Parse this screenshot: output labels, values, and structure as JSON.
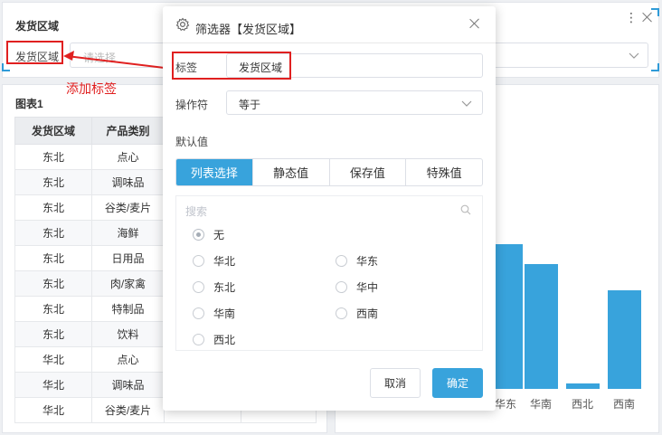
{
  "filter_widget": {
    "title": "发货区域",
    "label": "发货区域",
    "placeholder": "请选择",
    "menu_icon": "more-vertical-icon",
    "close_icon": "close-icon"
  },
  "annotation": {
    "text": "添加标签",
    "color": "#e02020"
  },
  "table_widget": {
    "title": "图表1",
    "columns": [
      "发货区域",
      "产品类别",
      "",
      ""
    ],
    "rows": [
      [
        "东北",
        "点心"
      ],
      [
        "东北",
        "调味品"
      ],
      [
        "东北",
        "谷类/麦片"
      ],
      [
        "东北",
        "海鲜"
      ],
      [
        "东北",
        "日用品"
      ],
      [
        "东北",
        "肉/家禽"
      ],
      [
        "东北",
        "特制品"
      ],
      [
        "东北",
        "饮料"
      ],
      [
        "华北",
        "点心"
      ],
      [
        "华北",
        "调味品"
      ],
      [
        "华北",
        "谷类/麦片"
      ]
    ]
  },
  "chart_data": {
    "type": "bar",
    "categories": [
      "华东",
      "华南",
      "西北",
      "西南"
    ],
    "values": [
      151,
      130,
      6,
      103
    ],
    "ylim": [
      0,
      160
    ],
    "color": "#38a3dc"
  },
  "dialog": {
    "title": "筛选器【发货区域】",
    "tag_label": "标签",
    "tag_value": "发货区域",
    "operator_label": "操作符",
    "operator_value": "等于",
    "default_label": "默认值",
    "tabs": [
      "列表选择",
      "静态值",
      "保存值",
      "特殊值"
    ],
    "active_tab": 0,
    "search_placeholder": "搜索",
    "options": [
      "无",
      "华北",
      "华东",
      "东北",
      "华中",
      "华南",
      "西南",
      "西北"
    ],
    "selected_option": "无",
    "cancel_label": "取消",
    "ok_label": "确定",
    "accent": "#38a3dc"
  }
}
